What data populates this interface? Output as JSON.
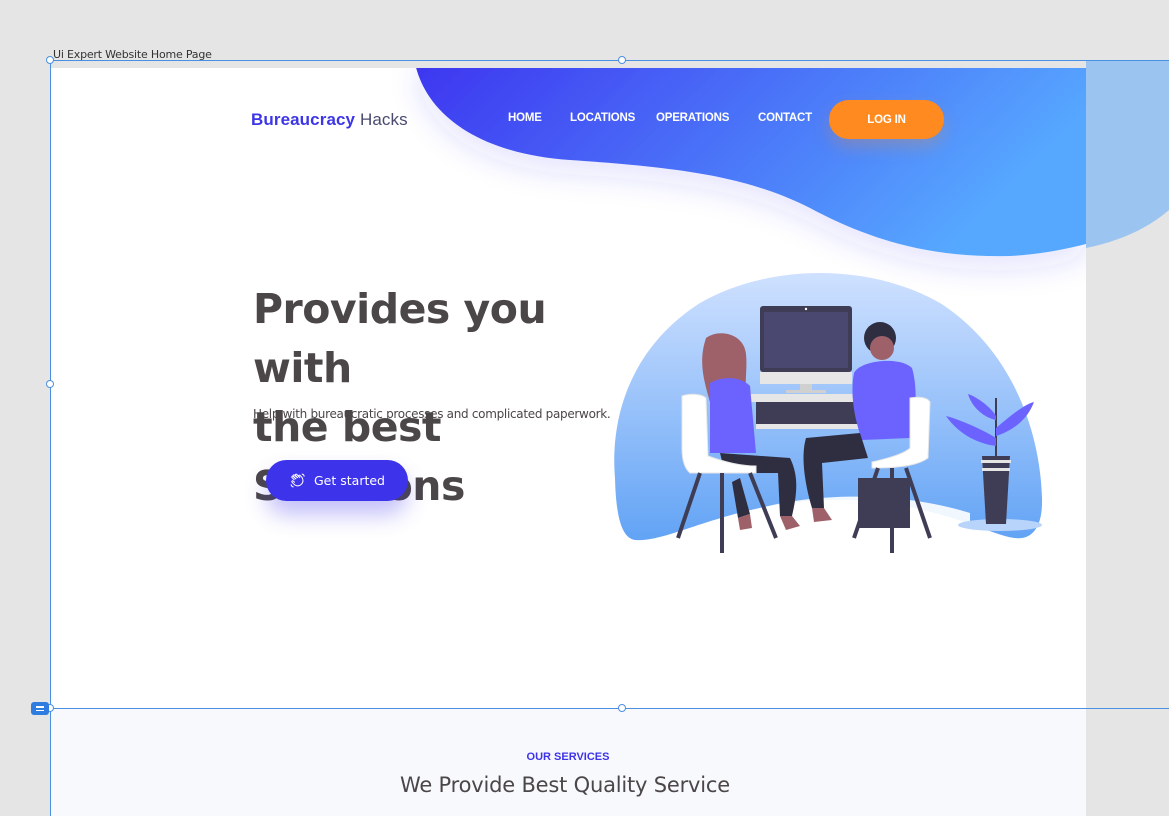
{
  "artboard": {
    "label": "Ui Expert Website Home Page"
  },
  "brand": {
    "name_bold": "Bureaucracy",
    "name_light": "Hacks"
  },
  "nav": {
    "items": [
      {
        "label": "HOME"
      },
      {
        "label": "LOCATIONS"
      },
      {
        "label": "OPERATIONS"
      },
      {
        "label": "CONTACT"
      }
    ],
    "login_label": "LOG IN"
  },
  "hero": {
    "title_line1": "Provides you with",
    "title_line2": "the best Solutions",
    "subtitle": "Help with bureaucratic processes and complicated paperwork.",
    "cta_label": "Get started",
    "cta_icon": "waving-hand-icon"
  },
  "services": {
    "kicker": "OUR SERVICES",
    "title": "We Provide Best Quality Service"
  },
  "colors": {
    "primary": "#3d33ea",
    "accent": "#ff8a1f",
    "gradient_start": "#3d35f0",
    "gradient_end": "#56a8ff",
    "text": "#4b4647"
  }
}
